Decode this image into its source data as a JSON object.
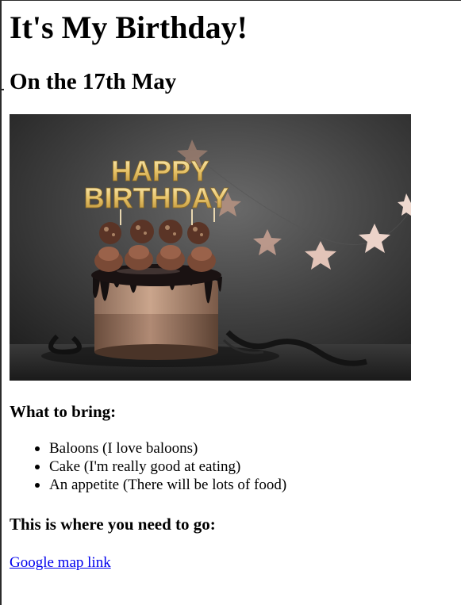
{
  "page": {
    "title": "It's My Birthday!",
    "subtitle": "On the 17th May"
  },
  "image": {
    "topper_line1": "HAPPY",
    "topper_line2": "BIRTHDAY"
  },
  "bring": {
    "heading": "What to bring:",
    "items": [
      "Baloons (I love baloons)",
      "Cake (I'm really good at eating)",
      "An appetite (There will be lots of food)"
    ]
  },
  "location": {
    "heading": "This is where you need to go:",
    "link_text": "Google map link"
  }
}
